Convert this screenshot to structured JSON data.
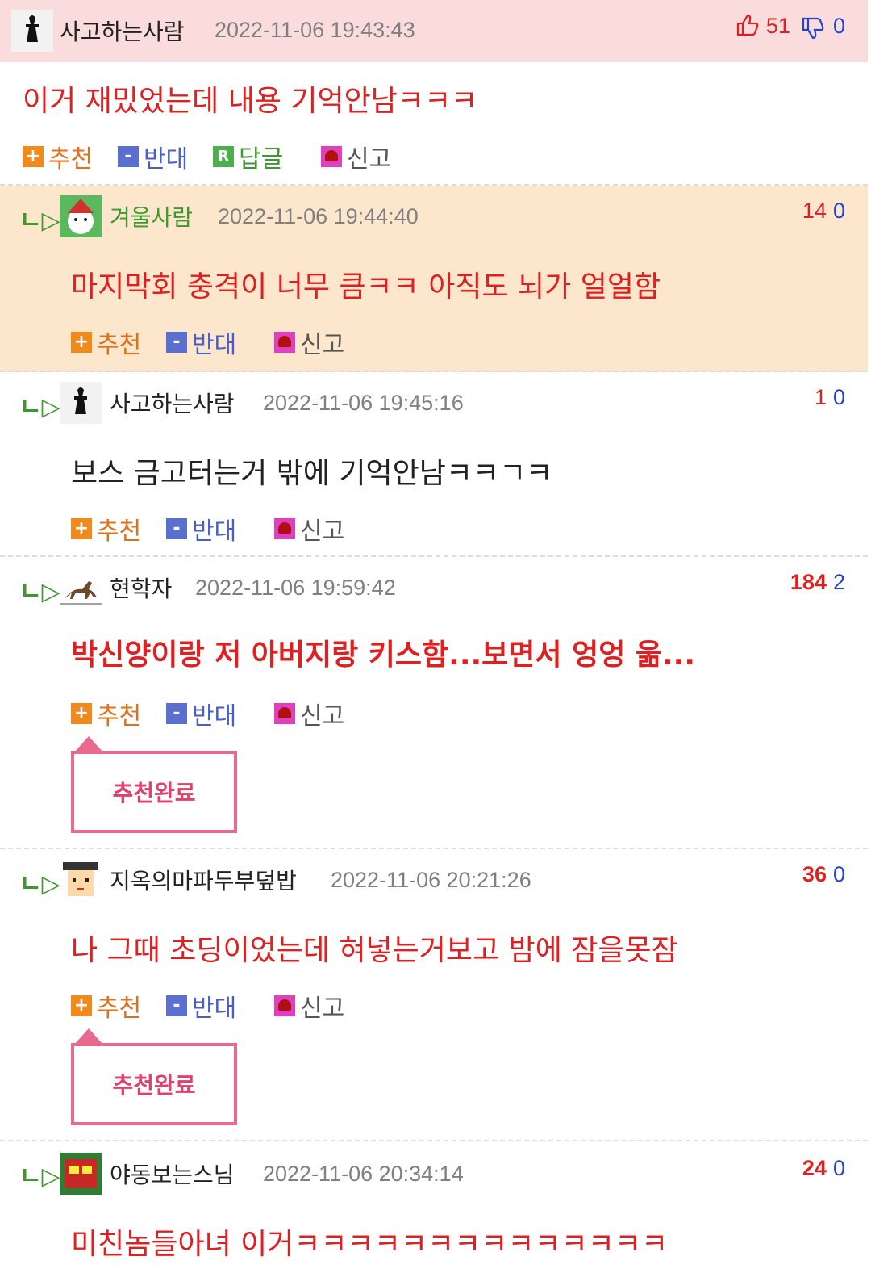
{
  "comments": [
    {
      "nick": "사고하는사람",
      "date": "2022-11-06 19:43:43",
      "up": "51",
      "down": "0",
      "body": "이거 재밌었는데 내용 기억안남ㅋㅋㅋ",
      "actions": {
        "up": "추천",
        "down": "반대",
        "reply": "답글",
        "report": "신고"
      }
    },
    {
      "nick": "겨울사람",
      "date": "2022-11-06 19:44:40",
      "up": "14",
      "down": "0",
      "body": "마지막회 충격이 너무 큼ㅋㅋ 아직도 뇌가 얼얼함",
      "actions": {
        "up": "추천",
        "down": "반대",
        "report": "신고"
      }
    },
    {
      "nick": "사고하는사람",
      "date": "2022-11-06 19:45:16",
      "up": "1",
      "down": "0",
      "body": "보스 금고터는거 밖에 기억안남ㅋㅋㄱㅋ",
      "actions": {
        "up": "추천",
        "down": "반대",
        "report": "신고"
      }
    },
    {
      "nick": "현학자",
      "date": "2022-11-06 19:59:42",
      "up": "184",
      "down": "2",
      "body": "박신양이랑 저 아버지랑 키스함...보면서 엉엉 욺...",
      "actions": {
        "up": "추천",
        "down": "반대",
        "report": "신고"
      },
      "done": "추천완료"
    },
    {
      "nick": "지옥의마파두부덮밥",
      "date": "2022-11-06 20:21:26",
      "up": "36",
      "down": "0",
      "body": "나 그때 초딩이었는데 혀넣는거보고 밤에 잠을못잠",
      "actions": {
        "up": "추천",
        "down": "반대",
        "report": "신고"
      },
      "done": "추천완료"
    },
    {
      "nick": "야동보는스님",
      "date": "2022-11-06 20:34:14",
      "up": "24",
      "down": "0",
      "body": "미친놈들아녀 이거ㅋㅋㅋㅋㅋㅋㅋㅋㅋㅋㅋㅋㅋㅋ"
    }
  ],
  "icons": {
    "reply_arrow": "ㄴ▷",
    "plus": "+",
    "minus": "-",
    "r": "R",
    "thumbs_up": "thumbs-up-icon",
    "thumbs_down": "thumbs-down-icon"
  },
  "colors": {
    "best_header_bg": "#fbdcdc",
    "highlight_bg": "#fce6cc",
    "red_text": "#e02020",
    "blue_count": "#2244cc",
    "reply_green": "#3a9a2a"
  }
}
